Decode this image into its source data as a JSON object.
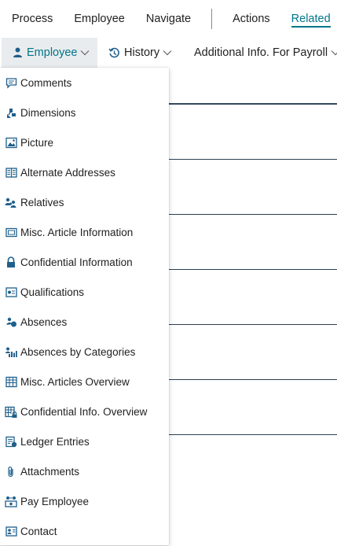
{
  "actionbar": {
    "tabs": [
      "Process",
      "Employee",
      "Navigate",
      "Actions",
      "Related"
    ],
    "active_tab": "Related"
  },
  "subbar": {
    "employee": "Employee",
    "history": "History",
    "additional": "Additional Info. For Payroll"
  },
  "menu": {
    "items": [
      {
        "label": "Comments",
        "icon": "comment-icon"
      },
      {
        "label": "Dimensions",
        "icon": "dimensions-icon"
      },
      {
        "label": "Picture",
        "icon": "picture-icon"
      },
      {
        "label": "Alternate Addresses",
        "icon": "address-book-icon"
      },
      {
        "label": "Relatives",
        "icon": "people-icon"
      },
      {
        "label": "Misc. Article Information",
        "icon": "article-icon"
      },
      {
        "label": "Confidential Information",
        "icon": "lock-icon"
      },
      {
        "label": "Qualifications",
        "icon": "certificate-icon"
      },
      {
        "label": "Absences",
        "icon": "absence-icon"
      },
      {
        "label": "Absences by Categories",
        "icon": "absence-category-icon"
      },
      {
        "label": "Misc. Articles Overview",
        "icon": "grid-list-icon"
      },
      {
        "label": "Confidential Info. Overview",
        "icon": "grid-lock-icon"
      },
      {
        "label": "Ledger Entries",
        "icon": "ledger-icon"
      },
      {
        "label": "Attachments",
        "icon": "paperclip-icon"
      },
      {
        "label": "Pay Employee",
        "icon": "pay-icon"
      },
      {
        "label": "Contact",
        "icon": "contact-card-icon"
      }
    ]
  },
  "colors": {
    "accent": "#00758a",
    "icon": "#1f5f8b",
    "selected_bg": "#e9ecee",
    "text": "#212121"
  }
}
